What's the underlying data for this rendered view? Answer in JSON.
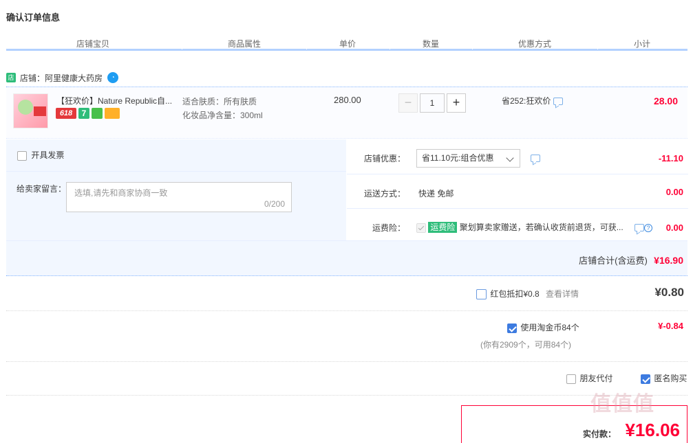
{
  "page_title": "确认订单信息",
  "columns": [
    "店铺宝贝",
    "商品属性",
    "单价",
    "数量",
    "优惠方式",
    "小计"
  ],
  "shop": {
    "label": "店铺：阿里健康大药房",
    "shop_icon": "shop-icon",
    "chat_icon": "wangwang-icon"
  },
  "item": {
    "name": "【狂欢价】Nature Republic自...",
    "badges": [
      "618",
      "7"
    ],
    "attrs": [
      "适合肤质：所有肤质",
      "化妆品净含量：300ml"
    ],
    "price": "280.00",
    "quantity": "1",
    "minus": "−",
    "plus": "+",
    "promo": "省252:狂欢价",
    "subtotal": "28.00"
  },
  "invoice": {
    "label": "开具发票",
    "checked": false
  },
  "message": {
    "label": "给卖家留言：",
    "placeholder": "选填,请先和商家协商一致",
    "counter": "0/200"
  },
  "shop_discount": {
    "label": "店铺优惠：",
    "selected": "省11.10元:组合优惠",
    "value": "-11.10"
  },
  "shipping": {
    "label": "运送方式：",
    "method": "快递 免邮",
    "value": "0.00"
  },
  "insurance": {
    "label": "运费险：",
    "tag": "运费险",
    "desc": "聚划算卖家赠送，若确认收货前退货，可获...",
    "help": "?",
    "value": "0.00"
  },
  "shop_total": {
    "label": "店铺合计(含运费)",
    "value": "¥16.90"
  },
  "redpacket": {
    "label": "红包抵扣¥0.8",
    "link": "查看详情",
    "value": "¥0.80",
    "checked": false
  },
  "taojinbi": {
    "label": "使用淘金币84个",
    "note": "(你有2909个，可用84个)",
    "value": "¥-0.84",
    "checked": true
  },
  "friend_pay": {
    "label": "朋友代付",
    "checked": false
  },
  "anonymous": {
    "label": "匿名购买",
    "checked": true
  },
  "final": {
    "label": "实付款：",
    "value": "¥16.06"
  },
  "watermark": "值值值",
  "colors": {
    "accent_red": "#ff0036",
    "header_line": "#b2d1ff",
    "panel_bg": "#f2f7ff",
    "check_blue": "#3d7be0"
  }
}
